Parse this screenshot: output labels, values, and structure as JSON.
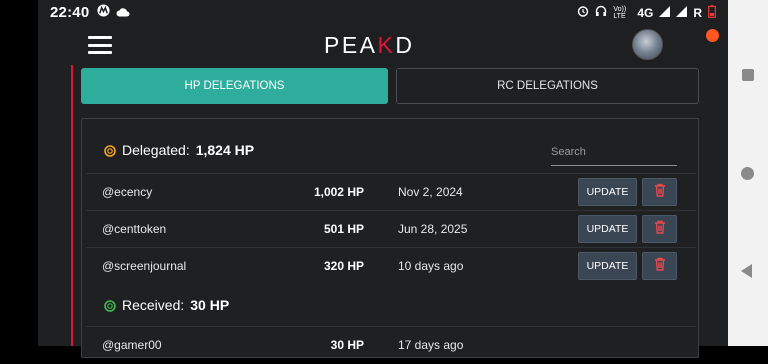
{
  "status_bar": {
    "time": "22:40",
    "left_icons": [
      "motorola-icon",
      "cloud-icon"
    ],
    "right_icons": [
      "alarm-icon",
      "headphones-icon",
      "volte-icon",
      "signal-icon",
      "signal-icon",
      "battery-low-icon"
    ],
    "volte_label": "Vo)) LTE",
    "network": "4G",
    "roaming": "R"
  },
  "header": {
    "logo_prefix": "PEA",
    "logo_k": "K",
    "logo_suffix": "D",
    "brand_color": "#e31337"
  },
  "tabs": [
    {
      "label": "HP DELEGATIONS",
      "active": true
    },
    {
      "label": "RC DELEGATIONS",
      "active": false
    }
  ],
  "delegated": {
    "label": "Delegated:",
    "amount": "1,824 HP",
    "icon_color": "#f5a623",
    "search_placeholder": "Search",
    "rows": [
      {
        "user": "@ecency",
        "hp": "1,002 HP",
        "date": "Nov 2, 2024",
        "update_label": "UPDATE"
      },
      {
        "user": "@centtoken",
        "hp": "501 HP",
        "date": "Jun 28, 2025",
        "update_label": "UPDATE"
      },
      {
        "user": "@screenjournal",
        "hp": "320 HP",
        "date": "10 days ago",
        "update_label": "UPDATE"
      }
    ]
  },
  "received": {
    "label": "Received:",
    "amount": "30 HP",
    "icon_color": "#3fb950",
    "rows": [
      {
        "user": "@gamer00",
        "hp": "30 HP",
        "date": "17 days ago"
      }
    ]
  },
  "colors": {
    "accent": "#2eac9c",
    "danger": "#e5484d",
    "notification": "#ff5722"
  }
}
